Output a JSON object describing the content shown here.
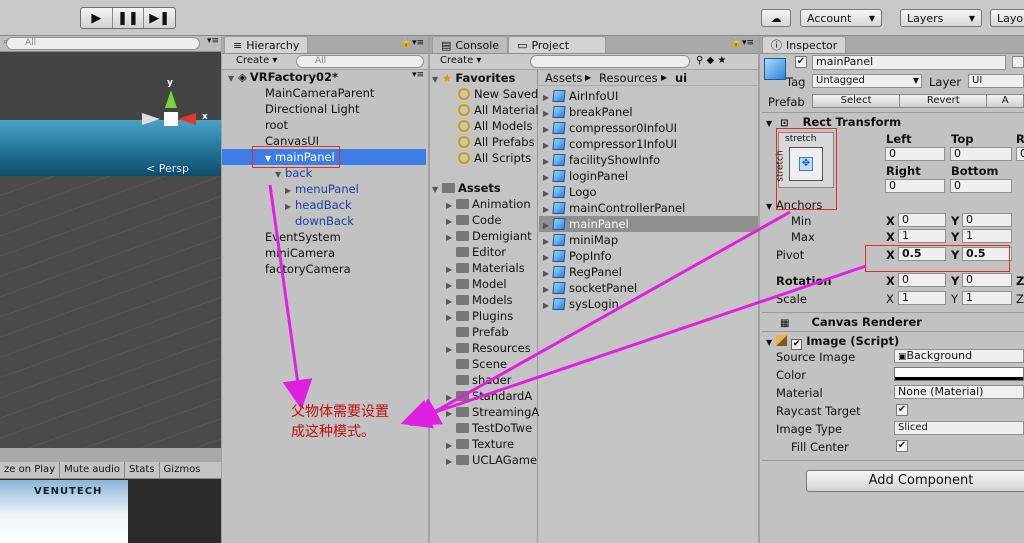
{
  "toolbar": {
    "cloud_icon": "cloud-icon",
    "account": "Account",
    "layers": "Layers",
    "layout": "Layo"
  },
  "scene": {
    "persp_label": "< Persp",
    "gizmo_y": "y",
    "gizmo_x": "x",
    "search_placeholder": "All",
    "game_buttons": [
      "ze on Play",
      "Mute audio",
      "Stats",
      "Gizmos"
    ],
    "game_logo": "VENUTECH"
  },
  "hierarchy": {
    "tab": "Hierarchy",
    "create": "Create",
    "search_placeholder": "All",
    "scene_name": "VRFactory02*",
    "items": [
      {
        "label": "MainCameraParent",
        "indent": 0,
        "style": "normal"
      },
      {
        "label": "Directional Light",
        "indent": 0,
        "style": "normal"
      },
      {
        "label": "root",
        "indent": 0,
        "style": "normal"
      },
      {
        "label": "CanvasUI",
        "indent": 0,
        "style": "normal"
      },
      {
        "label": "mainPanel",
        "indent": 1,
        "style": "selected",
        "arrow": "▼"
      },
      {
        "label": "back",
        "indent": 2,
        "style": "blue",
        "arrow": "▼"
      },
      {
        "label": "menuPanel",
        "indent": 3,
        "style": "blue",
        "arrow": "▶"
      },
      {
        "label": "headBack",
        "indent": 3,
        "style": "blue",
        "arrow": "▶"
      },
      {
        "label": "downBack",
        "indent": 3,
        "style": "blue"
      },
      {
        "label": "EventSystem",
        "indent": 0,
        "style": "normal"
      },
      {
        "label": "miniCamera",
        "indent": 0,
        "style": "normal"
      },
      {
        "label": "factoryCamera",
        "indent": 0,
        "style": "normal"
      }
    ]
  },
  "project": {
    "console_tab": "Console",
    "project_tab": "Project",
    "create": "Create",
    "favorites_title": "Favorites",
    "favorites": [
      "New Saved",
      "All Material",
      "All Models",
      "All Prefabs",
      "All Scripts"
    ],
    "assets_title": "Assets",
    "folders": [
      "Animation",
      "Code",
      "Demigiant",
      "Editor",
      "Materials",
      "Model",
      "Models",
      "Plugins",
      "Prefab",
      "Resources",
      "Scene",
      "shader",
      "StandardA",
      "StreamingA",
      "TestDoTwe",
      "Texture",
      "UCLAGame"
    ],
    "breadcrumb": [
      "Assets",
      "Resources",
      "ui"
    ],
    "files": [
      "AirInfoUI",
      "breakPanel",
      "compressor0InfoUI",
      "compressor1InfoUI",
      "facilityShowInfo",
      "loginPanel",
      "Logo",
      "mainControllerPanel",
      "mainPanel",
      "miniMap",
      "PopInfo",
      "RegPanel",
      "socketPanel",
      "sysLogin"
    ],
    "selected_file": "mainPanel"
  },
  "inspector": {
    "tab": "Inspector",
    "object_name": "mainPanel",
    "tag_label": "Tag",
    "tag_value": "Untagged",
    "layer_label": "Layer",
    "layer_value": "UI",
    "prefab_label": "Prefab",
    "prefab_select": "Select",
    "prefab_revert": "Revert",
    "prefab_apply": "A",
    "rect_title": "Rect Transform",
    "stretch_h": "stretch",
    "stretch_v": "stretch",
    "left_label": "Left",
    "top_label": "Top",
    "right_col_label": "R",
    "left_val": "0",
    "top_val": "0",
    "right_label": "Right",
    "bottom_label": "Bottom",
    "right_val": "0",
    "bottom_val": "0",
    "right_cut": "0",
    "anchors_label": "Anchors",
    "min_label": "Min",
    "max_label": "Max",
    "min_x": "0",
    "min_y": "0",
    "max_x": "1",
    "max_y": "1",
    "pivot_label": "Pivot",
    "pivot_x": "0.5",
    "pivot_y": "0.5",
    "rotation_label": "Rotation",
    "rot_x": "0",
    "rot_y": "0",
    "scale_label": "Scale",
    "scale_x": "1",
    "scale_y": "1",
    "z": "Z",
    "canvas_renderer": "Canvas Renderer",
    "image_title": "Image (Script)",
    "source_image_label": "Source Image",
    "source_image": "Background",
    "color_label": "Color",
    "material_label": "Material",
    "material": "None (Material)",
    "raycast_label": "Raycast Target",
    "image_type_label": "Image Type",
    "image_type": "Sliced",
    "fill_center_label": "Fill Center",
    "add_component": "Add Component"
  },
  "annotation": {
    "line1": "父物体需要设置",
    "line2": "成这种模式。",
    "color": "#e020e0"
  }
}
